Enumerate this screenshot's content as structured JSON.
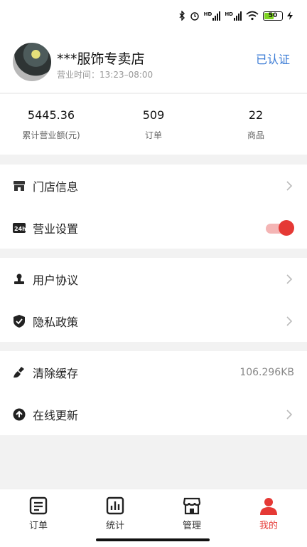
{
  "status_bar": {
    "battery": "50",
    "icons": [
      "bluetooth-icon",
      "alarm-icon",
      "signal-hd-icon",
      "signal-hd-icon",
      "wifi-icon",
      "battery-icon",
      "charging-icon"
    ],
    "hd1": "HD",
    "hd2": "HD"
  },
  "store": {
    "name": "***服饰专卖店",
    "hours": "营业时间：13:23–08:00",
    "verified": "已认证"
  },
  "stats": [
    {
      "value": "5445.36",
      "label": "累计营业额(元)"
    },
    {
      "value": "509",
      "label": "订单"
    },
    {
      "value": "22",
      "label": "商品"
    }
  ],
  "menu": {
    "store_info": "门店信息",
    "business_settings": "营业设置",
    "user_agreement": "用户协议",
    "privacy_policy": "隐私政策",
    "clear_cache": "清除缓存",
    "cache_size": "106.296KB",
    "online_update": "在线更新",
    "business_toggle_on": true
  },
  "tabs": [
    {
      "label": "订单",
      "icon": "order-icon"
    },
    {
      "label": "统计",
      "icon": "stats-icon"
    },
    {
      "label": "管理",
      "icon": "store-manage-icon"
    },
    {
      "label": "我的",
      "icon": "profile-icon"
    }
  ],
  "colors": {
    "accent": "#e53935",
    "verified": "#3a7bd5"
  }
}
